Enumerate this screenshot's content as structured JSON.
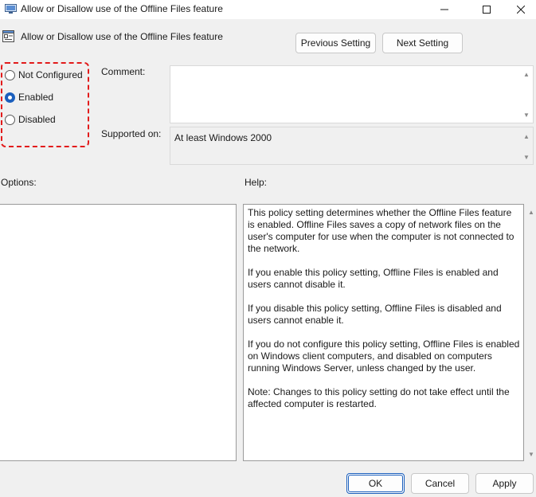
{
  "window": {
    "title": "Allow or Disallow use of the Offline Files feature",
    "icon": "policy-app-icon",
    "controls": [
      "minimize-icon",
      "maximize-icon",
      "close-icon"
    ]
  },
  "header": {
    "title": "Allow or Disallow use of the Offline Files feature",
    "previous_setting_label": "Previous Setting",
    "next_setting_label": "Next Setting"
  },
  "state": {
    "options": [
      {
        "label": "Not Configured",
        "selected": false
      },
      {
        "label": "Enabled",
        "selected": true
      },
      {
        "label": "Disabled",
        "selected": false
      }
    ],
    "highlight_color": "#e21b1b"
  },
  "comment": {
    "label": "Comment:",
    "value": ""
  },
  "supported_on": {
    "label": "Supported on:",
    "value": "At least Windows 2000"
  },
  "options_panel": {
    "label": "Options:"
  },
  "help_panel": {
    "label": "Help:",
    "paragraphs": [
      "This policy setting determines whether the Offline Files feature is enabled. Offline Files saves a copy of network files on the user's computer for use when the computer is not connected to the network.",
      "If you enable this policy setting, Offline Files is enabled and users cannot disable it.",
      "If you disable this policy setting, Offline Files is disabled and users cannot enable it.",
      "If you do not configure this policy setting, Offline Files is enabled on Windows client computers, and disabled on computers running Windows Server, unless changed by the user.",
      "Note: Changes to this policy setting do not take effect until the affected computer is restarted."
    ]
  },
  "footer": {
    "ok_label": "OK",
    "cancel_label": "Cancel",
    "apply_label": "Apply"
  },
  "colors": {
    "accent": "#1b5fbd",
    "window_bg": "#f0f0f0",
    "titlebar_bg": "#ffffff"
  }
}
